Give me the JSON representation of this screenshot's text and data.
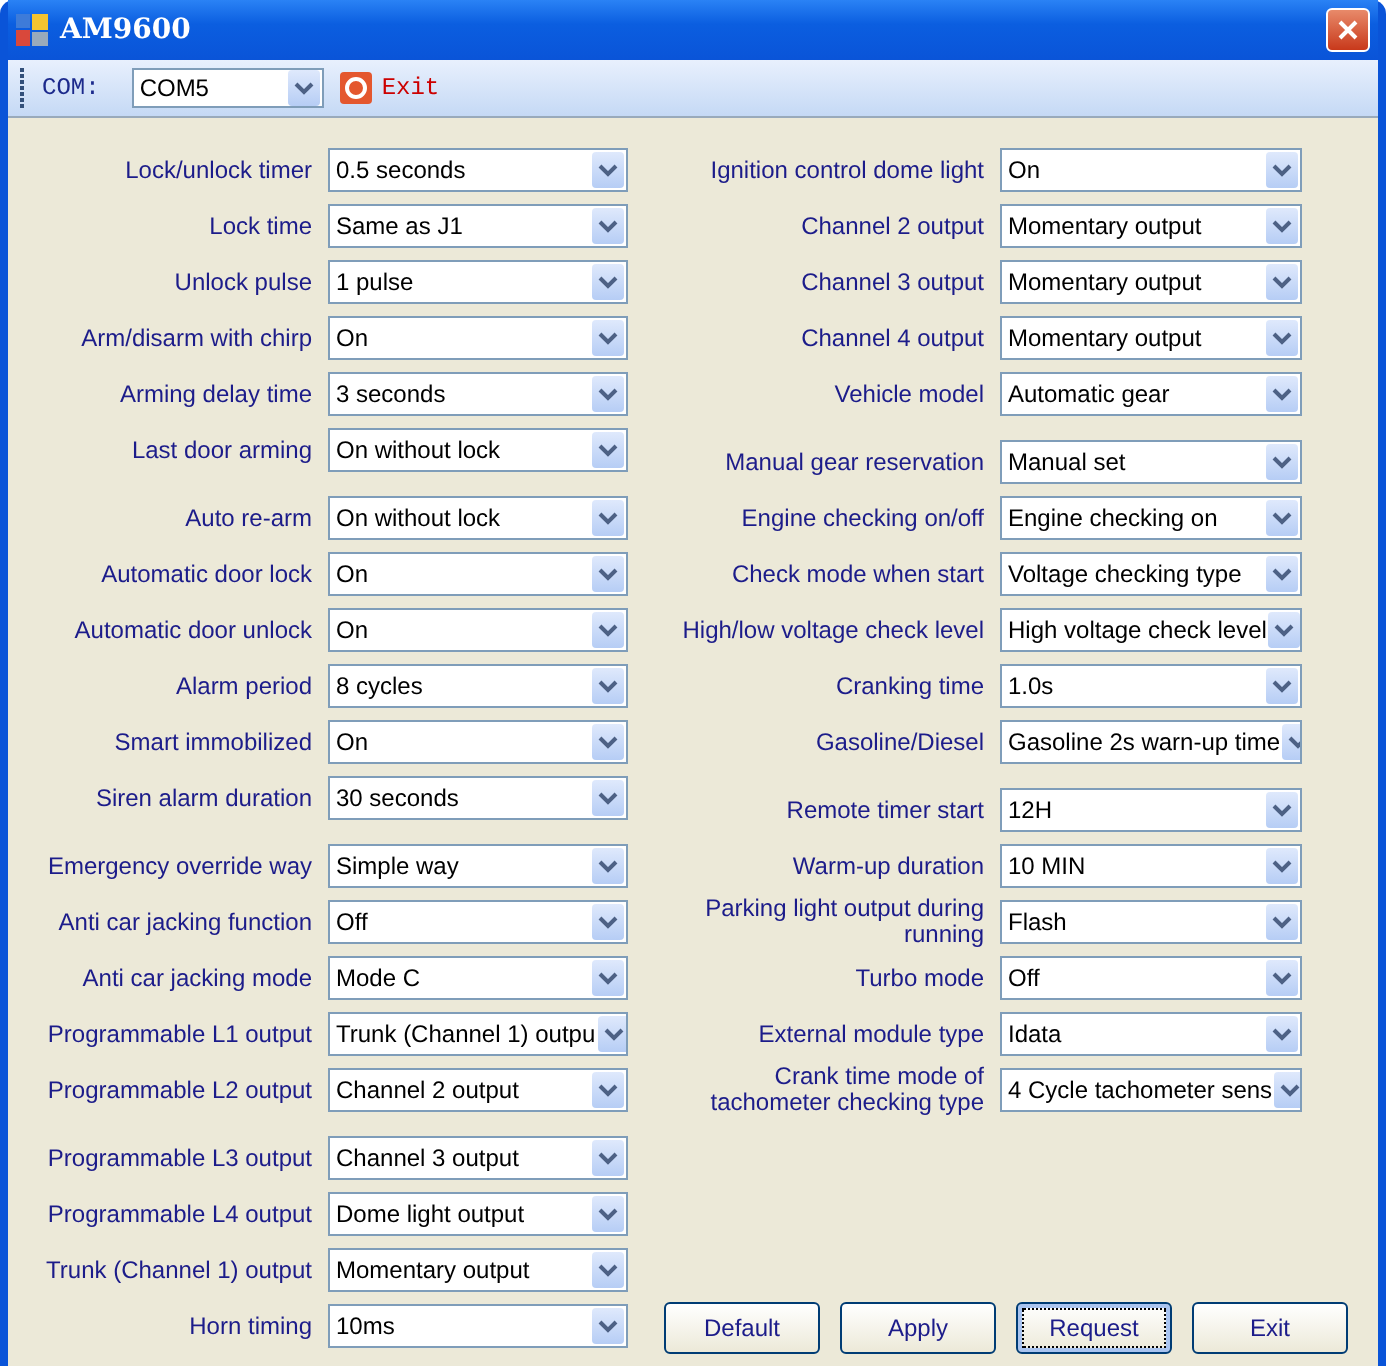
{
  "window": {
    "title": "AM9600"
  },
  "toolbar": {
    "com_label": "COM:",
    "com_value": "COM5",
    "exit_label": "Exit"
  },
  "left_groups": [
    [
      {
        "label": "Lock/unlock timer",
        "value": "0.5 seconds"
      },
      {
        "label": "Lock time",
        "value": "Same as J1"
      },
      {
        "label": "Unlock pulse",
        "value": "1 pulse"
      },
      {
        "label": "Arm/disarm with chirp",
        "value": "On"
      },
      {
        "label": "Arming delay time",
        "value": "3 seconds"
      },
      {
        "label": "Last door arming",
        "value": "On without lock"
      }
    ],
    [
      {
        "label": "Auto re-arm",
        "value": "On without lock"
      },
      {
        "label": "Automatic door lock",
        "value": "On"
      },
      {
        "label": "Automatic door unlock",
        "value": "On"
      },
      {
        "label": "Alarm period",
        "value": "8 cycles"
      },
      {
        "label": "Smart immobilized",
        "value": "On"
      },
      {
        "label": "Siren alarm duration",
        "value": "30 seconds"
      }
    ],
    [
      {
        "label": "Emergency override way",
        "value": "Simple way"
      },
      {
        "label": "Anti car jacking function",
        "value": "Off"
      },
      {
        "label": "Anti car jacking mode",
        "value": "Mode C"
      },
      {
        "label": "Programmable L1 output",
        "value": "Trunk (Channel 1) outpu"
      },
      {
        "label": "Programmable L2 output",
        "value": "Channel 2 output"
      }
    ],
    [
      {
        "label": "Programmable L3 output",
        "value": "Channel 3 output"
      },
      {
        "label": "Programmable L4 output",
        "value": "Dome light output"
      },
      {
        "label": "Trunk (Channel 1) output",
        "value": "Momentary output"
      },
      {
        "label": "Horn timing",
        "value": "10ms"
      }
    ]
  ],
  "right_groups": [
    [
      {
        "label": "Ignition control dome light",
        "value": "On"
      },
      {
        "label": "Channel 2 output",
        "value": "Momentary output"
      },
      {
        "label": "Channel 3 output",
        "value": "Momentary output"
      },
      {
        "label": "Channel 4 output",
        "value": "Momentary output"
      },
      {
        "label": "Vehicle model",
        "value": "Automatic gear"
      }
    ],
    [
      {
        "label": "Manual gear reservation",
        "value": "Manual set"
      },
      {
        "label": "Engine checking on/off",
        "value": "Engine checking on"
      },
      {
        "label": "Check mode when start",
        "value": "Voltage checking type"
      },
      {
        "label": "High/low voltage check level",
        "value": "High voltage check level"
      },
      {
        "label": "Cranking time",
        "value": "1.0s"
      },
      {
        "label": "Gasoline/Diesel",
        "value": "Gasoline 2s warn-up time"
      }
    ],
    [
      {
        "label": "Remote timer start",
        "value": "12H"
      },
      {
        "label": "Warm-up duration",
        "value": "10 MIN"
      },
      {
        "label": "Parking light output during running",
        "value": "Flash"
      },
      {
        "label": "Turbo mode",
        "value": "Off"
      },
      {
        "label": "External module type",
        "value": "Idata"
      },
      {
        "label": "Crank time mode of tachometer checking type",
        "value": "4 Cycle tachometer sens"
      }
    ]
  ],
  "buttons": [
    {
      "label": "Default",
      "focused": false
    },
    {
      "label": "Apply",
      "focused": false
    },
    {
      "label": "Request",
      "focused": true
    },
    {
      "label": "Exit",
      "focused": false
    }
  ]
}
